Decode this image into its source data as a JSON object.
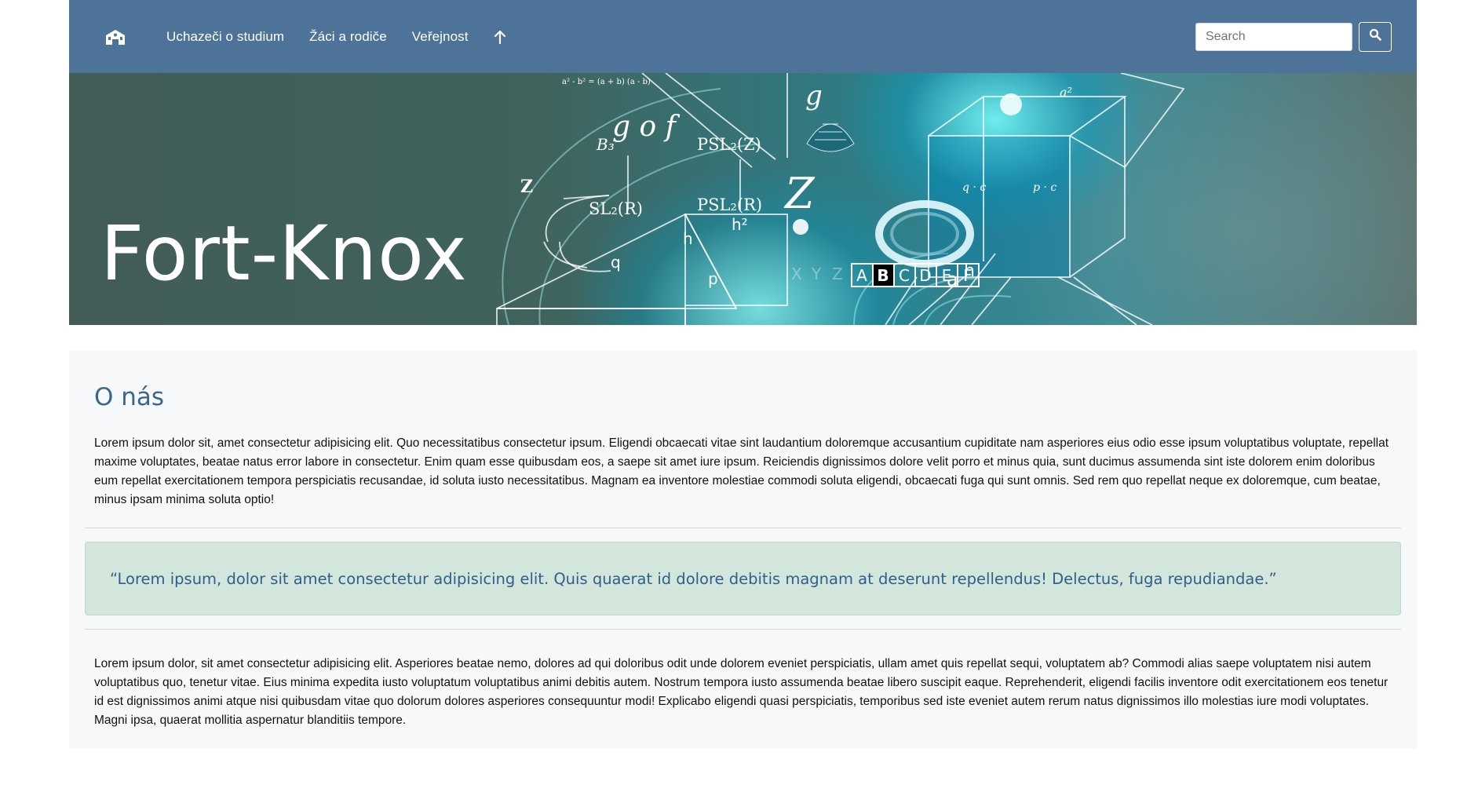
{
  "nav": {
    "links": [
      "Uchazeči o studium",
      "Žáci a rodiče",
      "Veřejnost"
    ],
    "search_placeholder": "Search"
  },
  "hero": {
    "title": "Fort-Knox",
    "formula_top": "a² - b² = (a + b) (a - b)",
    "gof": "g o f",
    "b3": "B₃",
    "psl2z": "PSL₂(Z)",
    "sl2r": "SL₂(R)",
    "psl2r": "PSL₂(R)",
    "z_left": "Z",
    "z_big": "Z",
    "g": "g",
    "h": "h",
    "h2": "h²",
    "q": "q",
    "p": "p",
    "a": "a",
    "h_right": "h",
    "a2": "a²",
    "qc": "q · c",
    "pc": "p · c",
    "letters": [
      "A",
      "B",
      "C",
      "D",
      "E",
      "F"
    ],
    "faded_letters": [
      "X",
      "Y",
      "Z"
    ]
  },
  "content": {
    "heading": "O nás",
    "paragraph1": "Lorem ipsum dolor sit, amet consectetur adipisicing elit. Quo necessitatibus consectetur ipsum. Eligendi obcaecati vitae sint laudantium doloremque accusantium cupiditate nam asperiores eius odio esse ipsum voluptatibus voluptate, repellat maxime voluptates, beatae natus error labore in consectetur. Enim quam esse quibusdam eos, a saepe sit amet iure ipsum. Reiciendis dignissimos dolore velit porro et minus quia, sunt ducimus assumenda sint iste dolorem enim doloribus eum repellat exercitationem tempora perspiciatis recusandae, id soluta iusto necessitatibus. Magnam ea inventore molestiae commodi soluta eligendi, obcaecati fuga qui sunt omnis. Sed rem quo repellat neque ex doloremque, cum beatae, minus ipsam minima soluta optio!",
    "quote": "“Lorem ipsum, dolor sit amet consectetur adipisicing elit. Quis quaerat id dolore debitis magnam at deserunt repellendus! Delectus, fuga repudiandae.”",
    "paragraph2": "Lorem ipsum dolor, sit amet consectetur adipisicing elit. Asperiores beatae nemo, dolores ad qui doloribus odit unde dolorem eveniet perspiciatis, ullam amet quis repellat sequi, voluptatem ab? Commodi alias saepe voluptatem nisi autem voluptatibus quo, tenetur vitae. Eius minima expedita iusto voluptatum voluptatibus animi debitis autem. Nostrum tempora iusto assumenda beatae libero suscipit eaque. Reprehenderit, eligendi facilis inventore odit exercitationem eos tenetur id est dignissimos animi atque nisi quibusdam vitae quo dolorum dolores asperiores consequuntur modi! Explicabo eligendi quasi perspiciatis, temporibus sed iste eveniet autem rerum natus dignissimos illo molestias iure modi voluptates. Magni ipsa, quaerat mollitia aspernatur blanditiis tempore."
  },
  "colors": {
    "navbar": "#4e7399",
    "heading": "#3b668f",
    "quote_bg": "#d2e6dc",
    "content_bg": "#f7f8fa"
  },
  "icons": {
    "brand": "school-building-icon",
    "up": "arrow-up-icon",
    "search": "magnifier-icon"
  }
}
